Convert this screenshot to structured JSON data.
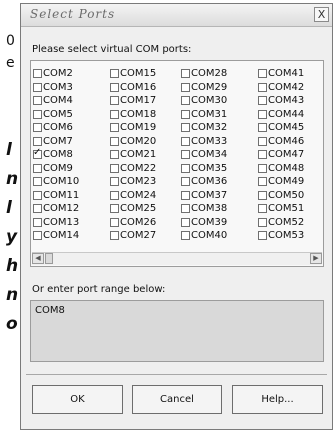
{
  "background": {
    "top_fragments": [
      "0",
      "e"
    ],
    "mid_fragments": [
      "l",
      "n",
      "l",
      "y",
      "h",
      "n",
      "o"
    ]
  },
  "dialog": {
    "title": "Select Ports",
    "close_label": "X",
    "instruction": "Please select virtual COM ports:",
    "ports": [
      {
        "name": "COM2",
        "checked": false
      },
      {
        "name": "COM15",
        "checked": false
      },
      {
        "name": "COM28",
        "checked": false
      },
      {
        "name": "COM41",
        "checked": false
      },
      {
        "name": "COM3",
        "checked": false
      },
      {
        "name": "COM16",
        "checked": false
      },
      {
        "name": "COM29",
        "checked": false
      },
      {
        "name": "COM42",
        "checked": false
      },
      {
        "name": "COM4",
        "checked": false
      },
      {
        "name": "COM17",
        "checked": false
      },
      {
        "name": "COM30",
        "checked": false
      },
      {
        "name": "COM43",
        "checked": false
      },
      {
        "name": "COM5",
        "checked": false
      },
      {
        "name": "COM18",
        "checked": false
      },
      {
        "name": "COM31",
        "checked": false
      },
      {
        "name": "COM44",
        "checked": false
      },
      {
        "name": "COM6",
        "checked": false
      },
      {
        "name": "COM19",
        "checked": false
      },
      {
        "name": "COM32",
        "checked": false
      },
      {
        "name": "COM45",
        "checked": false
      },
      {
        "name": "COM7",
        "checked": false
      },
      {
        "name": "COM20",
        "checked": false
      },
      {
        "name": "COM33",
        "checked": false
      },
      {
        "name": "COM46",
        "checked": false
      },
      {
        "name": "COM8",
        "checked": true
      },
      {
        "name": "COM21",
        "checked": false
      },
      {
        "name": "COM34",
        "checked": false
      },
      {
        "name": "COM47",
        "checked": false
      },
      {
        "name": "COM9",
        "checked": false
      },
      {
        "name": "COM22",
        "checked": false
      },
      {
        "name": "COM35",
        "checked": false
      },
      {
        "name": "COM48",
        "checked": false
      },
      {
        "name": "COM10",
        "checked": false
      },
      {
        "name": "COM23",
        "checked": false
      },
      {
        "name": "COM36",
        "checked": false
      },
      {
        "name": "COM49",
        "checked": false
      },
      {
        "name": "COM11",
        "checked": false
      },
      {
        "name": "COM24",
        "checked": false
      },
      {
        "name": "COM37",
        "checked": false
      },
      {
        "name": "COM50",
        "checked": false
      },
      {
        "name": "COM12",
        "checked": false
      },
      {
        "name": "COM25",
        "checked": false
      },
      {
        "name": "COM38",
        "checked": false
      },
      {
        "name": "COM51",
        "checked": false
      },
      {
        "name": "COM13",
        "checked": false
      },
      {
        "name": "COM26",
        "checked": false
      },
      {
        "name": "COM39",
        "checked": false
      },
      {
        "name": "COM52",
        "checked": false
      },
      {
        "name": "COM14",
        "checked": false
      },
      {
        "name": "COM27",
        "checked": false
      },
      {
        "name": "COM40",
        "checked": false
      },
      {
        "name": "COM53",
        "checked": false
      }
    ],
    "range_label": "Or enter port range below:",
    "range_value": "COM8",
    "buttons": {
      "ok": "OK",
      "cancel": "Cancel",
      "help": "Help..."
    }
  }
}
